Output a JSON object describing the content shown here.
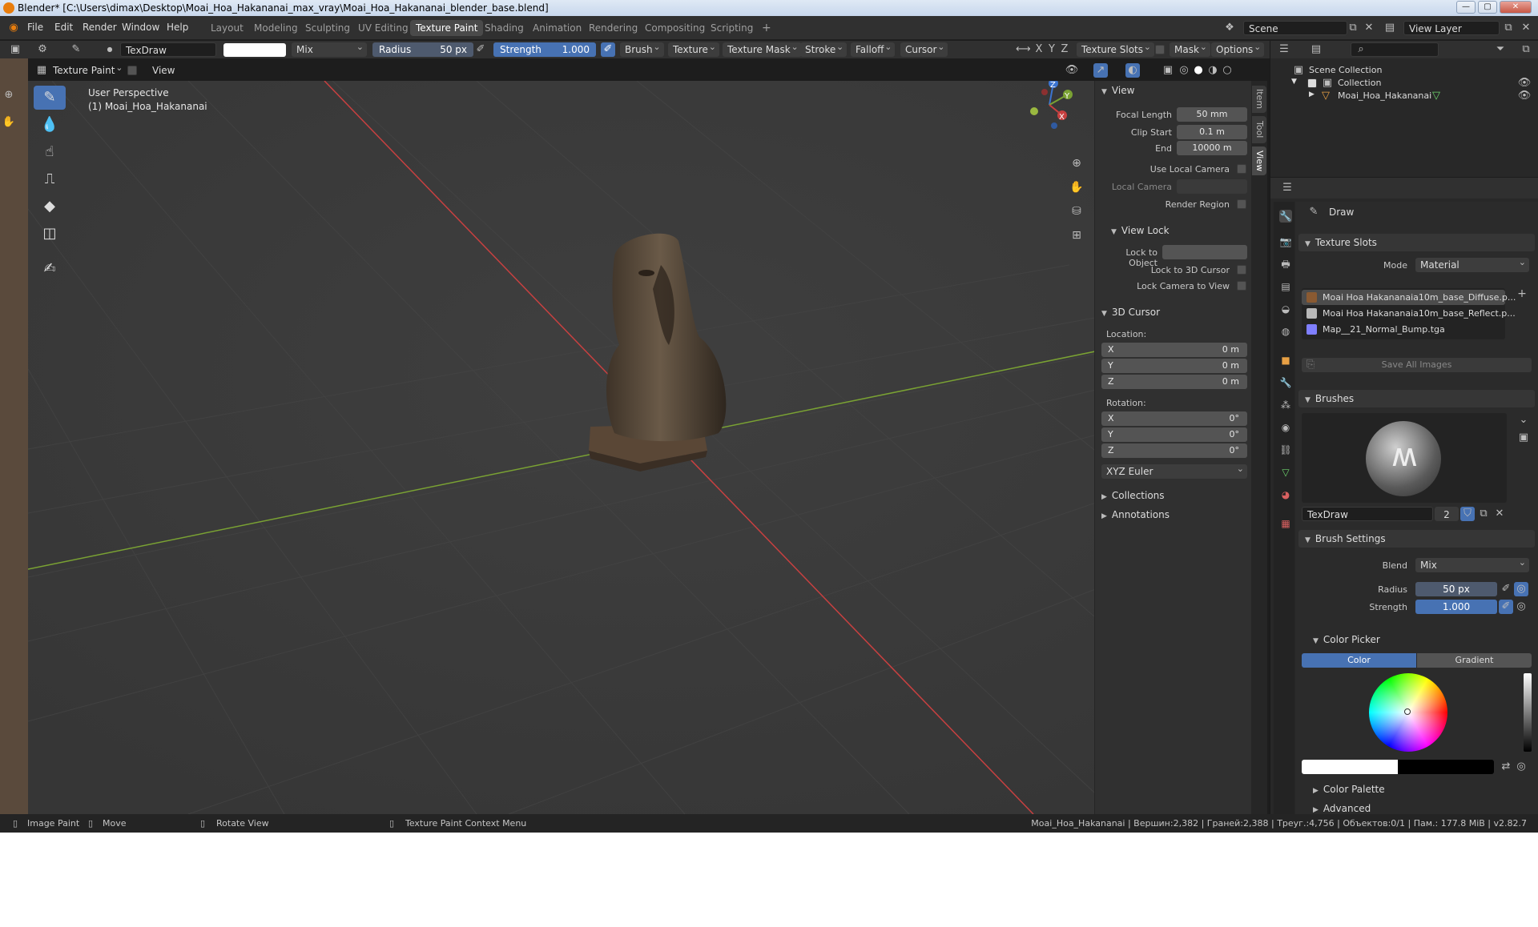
{
  "window": {
    "title": "Blender* [C:\\Users\\dimax\\Desktop\\Moai_Hoa_Hakananai_max_vray\\Moai_Hoa_Hakananai_blender_base.blend]"
  },
  "menu": [
    "File",
    "Edit",
    "Render",
    "Window",
    "Help"
  ],
  "workspaces": [
    "Layout",
    "Modeling",
    "Sculpting",
    "UV Editing",
    "Texture Paint",
    "Shading",
    "Animation",
    "Rendering",
    "Compositing",
    "Scripting"
  ],
  "active_workspace": "Texture Paint",
  "scene": {
    "name": "Scene",
    "view_layer": "View Layer"
  },
  "tool_header": {
    "brush_name": "TexDraw",
    "blend": "Mix",
    "radius_label": "Radius",
    "radius_value": "50 px",
    "strength_label": "Strength",
    "strength_value": "1.000",
    "menus": [
      "Brush",
      "Texture",
      "Texture Mask",
      "Stroke",
      "Falloff",
      "Cursor"
    ],
    "axes": [
      "X",
      "Y",
      "Z"
    ],
    "texture_slots": "Texture Slots",
    "mask": "Mask",
    "options": "Options"
  },
  "mode_header": {
    "mode": "Texture Paint",
    "view": "View"
  },
  "viewport": {
    "perspective": "User Perspective",
    "object": "(1) Moai_Hoa_Hakananai",
    "gizmo": {
      "x": "X",
      "y": "Y",
      "z": "Z"
    }
  },
  "npanel": {
    "tabs": [
      "Item",
      "Tool",
      "View"
    ],
    "active_tab": "View",
    "view": {
      "title": "View",
      "focal_length_label": "Focal Length",
      "focal_length": "50 mm",
      "clip_start_label": "Clip Start",
      "clip_start": "0.1 m",
      "end_label": "End",
      "end": "10000 m",
      "use_local_camera": "Use Local Camera",
      "local_camera": "Local Camera",
      "render_region": "Render Region"
    },
    "view_lock": {
      "title": "View Lock",
      "lock_to_object": "Lock to Object",
      "lock_3d_cursor": "Lock to 3D Cursor",
      "lock_camera": "Lock Camera to View"
    },
    "cursor": {
      "title": "3D Cursor",
      "location_label": "Location:",
      "location": [
        {
          "k": "X",
          "v": "0 m"
        },
        {
          "k": "Y",
          "v": "0 m"
        },
        {
          "k": "Z",
          "v": "0 m"
        }
      ],
      "rotation_label": "Rotation:",
      "rotation": [
        {
          "k": "X",
          "v": "0°"
        },
        {
          "k": "Y",
          "v": "0°"
        },
        {
          "k": "Z",
          "v": "0°"
        }
      ],
      "rotation_mode": "XYZ Euler"
    },
    "collections": "Collections",
    "annotations": "Annotations"
  },
  "outliner": {
    "root": "Scene Collection",
    "collection": "Collection",
    "object": "Moai_Hoa_Hakananai"
  },
  "properties": {
    "tool_name": "Draw",
    "texture_slots": {
      "title": "Texture Slots",
      "mode_label": "Mode",
      "mode": "Material",
      "items": [
        {
          "name": "Moai Hoa Hakananaia10m_base_Diffuse.p...",
          "color": "#8a5a32"
        },
        {
          "name": "Moai Hoa Hakananaia10m_base_Reflect.p...",
          "color": "#b8b8b8"
        },
        {
          "name": "Map__21_Normal_Bump.tga",
          "color": "#7f7fff"
        }
      ],
      "save_all": "Save All Images"
    },
    "brushes": {
      "title": "Brushes",
      "name": "TexDraw",
      "users": "2"
    },
    "brush_settings": {
      "title": "Brush Settings",
      "blend_label": "Blend",
      "blend": "Mix",
      "radius_label": "Radius",
      "radius": "50 px",
      "strength_label": "Strength",
      "strength": "1.000"
    },
    "color_picker": {
      "title": "Color Picker",
      "tab_color": "Color",
      "tab_gradient": "Gradient"
    },
    "color_palette": "Color Palette",
    "advanced": "Advanced"
  },
  "statusbar": {
    "image_paint": "Image Paint",
    "move": "Move",
    "rotate": "Rotate View",
    "context": "Texture Paint Context Menu",
    "stats": "Moai_Hoa_Hakananai | Вершин:2,382 | Граней:2,388 | Треуг.:4,756 | Объектов:0/1 | Пам.: 177.8 MiB | v2.82.7"
  },
  "colors": {
    "accent": "#4772b3",
    "x_axis": "#c84040",
    "y_axis": "#7aa233",
    "z_axis": "#3b74d1"
  }
}
